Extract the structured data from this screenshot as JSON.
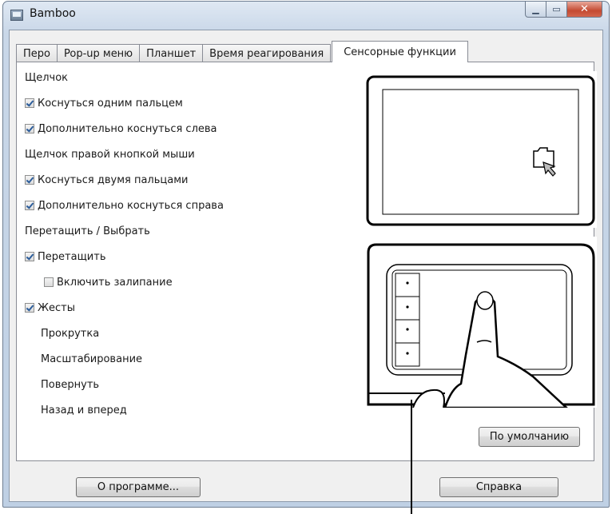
{
  "window": {
    "title": "Bamboo"
  },
  "tabs": [
    "Перо",
    "Pop-up меню",
    "Планшет",
    "Время реагирования",
    "Сенсорные функции"
  ],
  "settings": {
    "click_header": "Щелчок",
    "touch_one_finger": {
      "label": "Коснуться одним пальцем",
      "checked": true
    },
    "extra_touch_left": {
      "label": "Дополнительно коснуться слева",
      "checked": true
    },
    "right_click_header": "Щелчок правой кнопкой мыши",
    "touch_two_fingers": {
      "label": "Коснуться двумя пальцами",
      "checked": true
    },
    "extra_touch_right": {
      "label": "Дополнительно коснуться справа",
      "checked": true
    },
    "drag_header": "Перетащить / Выбрать",
    "drag": {
      "label": "Перетащить",
      "checked": true
    },
    "drag_lock": {
      "label": "Включить залипание",
      "checked": false
    },
    "gestures": {
      "label": "Жесты",
      "checked": true
    },
    "gesture_items": [
      "Прокрутка",
      "Масштабирование",
      "Повернуть",
      "Назад и вперед"
    ]
  },
  "buttons": {
    "defaults": "По умолчанию",
    "about": "О программе...",
    "help": "Справка"
  },
  "colors": {
    "window_frame": "#bfd0e4",
    "checkbox_mark": "#2c5d9b",
    "close_button": "#c44a32"
  },
  "icons": [
    "app-icon",
    "minimize-icon",
    "maximize-icon",
    "close-icon",
    "folder-cursor-icon",
    "finger-tap-icon"
  ]
}
